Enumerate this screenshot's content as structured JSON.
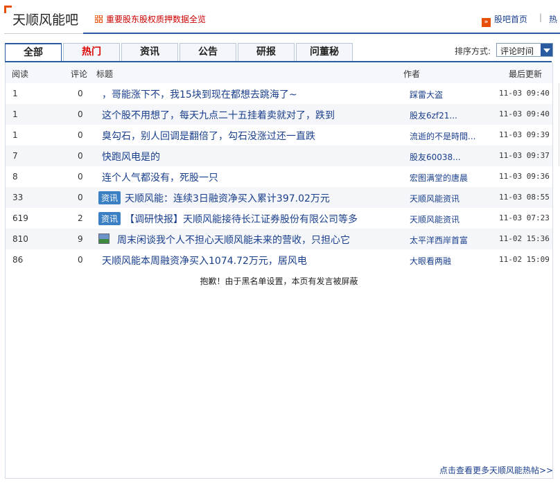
{
  "forum": {
    "title": "天顺风能吧",
    "promo_text": "重要股东股权质押数据全览",
    "home_link": "股吧首页",
    "separator": "|",
    "hot_link": "热"
  },
  "tabs": [
    {
      "label": "全部",
      "active": true
    },
    {
      "label": "热门",
      "hot": true
    },
    {
      "label": "资讯"
    },
    {
      "label": "公告"
    },
    {
      "label": "研报"
    },
    {
      "label": "问董秘"
    }
  ],
  "sort": {
    "label": "排序方式:",
    "value": "评论时间"
  },
  "columns": {
    "reads": "阅读",
    "comments": "评论",
    "title": "标题",
    "author": "作者",
    "updated": "最后更新"
  },
  "posts": [
    {
      "reads": "1",
      "comments": "0",
      "title": "，哥能涨下不，我15块到现在都想去跳海了~",
      "author": "踩雷大盗",
      "updated": "11-03 09:40"
    },
    {
      "reads": "1",
      "comments": "0",
      "title": "这个股不用想了，每天九点二十五挂着卖就对了，跌到",
      "author": "股友6zf21...",
      "updated": "11-03 09:40"
    },
    {
      "reads": "1",
      "comments": "0",
      "title": "臭勾石，别人回调是翻倍了，勾石没涨过还一直跌",
      "author": "流逝的不是時間...",
      "updated": "11-03 09:39"
    },
    {
      "reads": "7",
      "comments": "0",
      "title": "快跑风电是的",
      "author": "股友60038...",
      "updated": "11-03 09:37"
    },
    {
      "reads": "8",
      "comments": "0",
      "title": "连个人气都没有，死股一只",
      "author": "宏图满堂的唐晨",
      "updated": "11-03 09:36"
    },
    {
      "reads": "33",
      "comments": "0",
      "badge": "资讯",
      "title": "天顺风能：连续3日融资净买入累计397.02万元",
      "author": "天顺风能资讯",
      "updated": "11-03 08:55"
    },
    {
      "reads": "619",
      "comments": "2",
      "badge": "资讯",
      "title": "【调研快报】天顺风能接待长江证券股份有限公司等多",
      "author": "天顺风能资讯",
      "updated": "11-03 07:23"
    },
    {
      "reads": "810",
      "comments": "9",
      "image_icon": "image-icon",
      "title": "周末闲谈我个人不担心天顺风能未来的营收，只担心它",
      "author": "太平洋西岸首富",
      "updated": "11-02 15:36"
    },
    {
      "reads": "86",
      "comments": "0",
      "title": "天顺风能本周融资净买入1074.72万元，居风电",
      "author": "大眼看两融",
      "updated": "11-02 15:09"
    }
  ],
  "notice": "抱歉！由于黑名单设置，本页有发言被屏蔽",
  "more_link": "点击查看更多天顺风能热帖>>",
  "colors": {
    "accent": "#e8500a",
    "link": "#1a3f8c",
    "tab_border": "#2a5aa0",
    "hot": "#dd0000",
    "badge": "#3b7fc4"
  }
}
